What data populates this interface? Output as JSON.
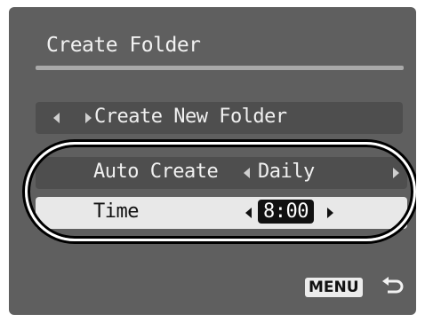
{
  "screen": {
    "title": "Create Folder",
    "rows": {
      "create_new_folder": {
        "label": "Create New Folder"
      },
      "auto_create": {
        "label": "Auto Create",
        "value": "Daily"
      },
      "time": {
        "label": "Time",
        "value": "8:00"
      }
    },
    "footer": {
      "menu_label": "MENU",
      "back_icon": "return-arrow-icon"
    }
  }
}
